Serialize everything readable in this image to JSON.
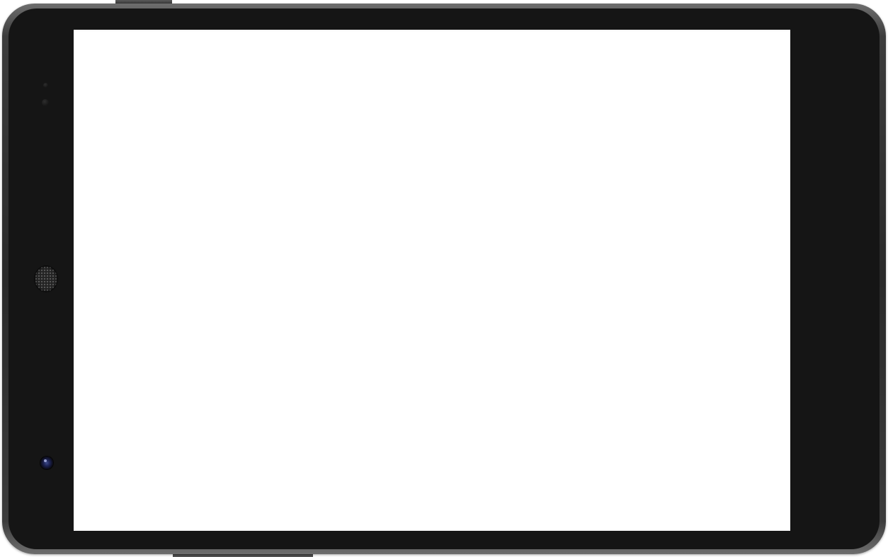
{
  "device": {
    "frame_color": "#151515",
    "screen_color": "#ffffff",
    "icons": {
      "speaker": "speaker-grille-icon",
      "camera": "front-camera-icon",
      "sensor": "light-sensor-icon"
    }
  }
}
